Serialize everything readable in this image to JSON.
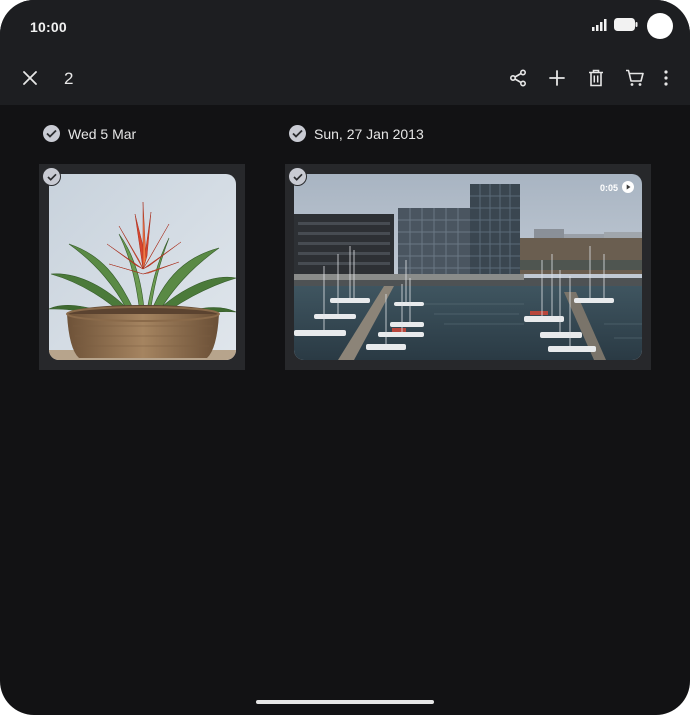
{
  "status_bar": {
    "time": "10:00",
    "icons": [
      "signal-icon",
      "battery-icon"
    ]
  },
  "toolbar": {
    "close_icon": "close-icon",
    "selected_count": "2",
    "actions": [
      "share-icon",
      "add-icon",
      "delete-icon",
      "order-prints-icon",
      "more-options-icon"
    ]
  },
  "groups": [
    {
      "date_label": "Wed 5 Mar",
      "items": [
        {
          "type": "photo",
          "subject": "potted-plant",
          "selected": true
        }
      ]
    },
    {
      "date_label": "Sun, 27 Jan 2013",
      "items": [
        {
          "type": "video",
          "subject": "harbour",
          "duration": "0:05",
          "selected": true
        }
      ]
    }
  ],
  "colors": {
    "background": "#121214",
    "toolbar": "#1d1e21",
    "check": "#c9cbd3",
    "text": "#e6e6e6"
  }
}
